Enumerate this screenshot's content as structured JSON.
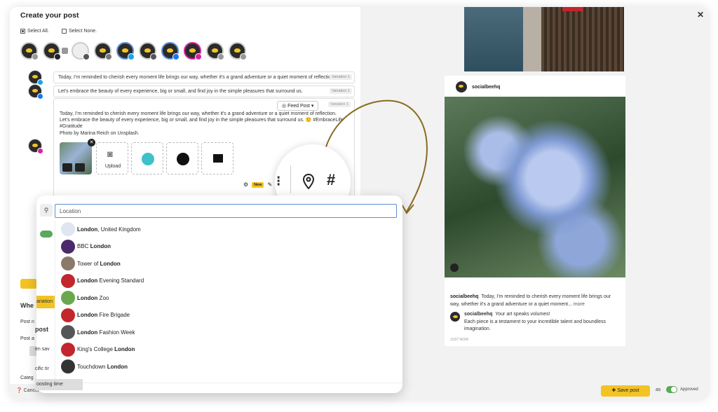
{
  "composer": {
    "title": "Create your post",
    "select_all": "Select All.",
    "select_none": "Select None.",
    "variations": [
      {
        "text": "Today, I'm reminded to cherish every moment life brings our way, whether it's a grand adventure or a quiet moment of reflection",
        "tag": "Variation 1"
      },
      {
        "text": "Let's embrace the beauty of every experience, big or small, and find joy in the simple pleasures that surround us.",
        "tag": "Variation 1"
      }
    ],
    "editor": {
      "post_type": "Feed Post",
      "tag": "Variation 1",
      "line1": "Today, I'm reminded to cherish every moment life brings our way, whether it's a grand adventure or a quiet moment of reflection.",
      "line2": "Let's embrace the beauty of every experience, big or small, and find joy in the simple pleasures that surround us. 🙂 #EmbraceLife",
      "line3": "#Gratitude",
      "line4": "Photo by Marina Reich on Unsplash.",
      "upload_label": "Upload",
      "new_badge": "New"
    },
    "partial_labels": {
      "when": "Whe",
      "post": "post",
      "variation": "ariation",
      "post_n": "Post n",
      "post_a": "Post a",
      "then_save": "en sav",
      "specific": "cific tir",
      "boosting": "oosting time",
      "category": "Categ"
    }
  },
  "location_dropdown": {
    "placeholder": "Location",
    "results": [
      {
        "bold": "London",
        "rest": ", United Kingdom",
        "prefix": "",
        "logo_color": "#dfe6f0"
      },
      {
        "bold": "London",
        "rest": "",
        "prefix": "BBC ",
        "logo_color": "#4a2a6a"
      },
      {
        "bold": "London",
        "rest": "",
        "prefix": "Tower of ",
        "logo_color": "#8a7a6a"
      },
      {
        "bold": "London",
        "rest": " Evening Standard",
        "prefix": "",
        "logo_color": "#c1272d"
      },
      {
        "bold": "London",
        "rest": " Zoo",
        "prefix": "",
        "logo_color": "#6aa84f"
      },
      {
        "bold": "London",
        "rest": " Fire Brigade",
        "prefix": "",
        "logo_color": "#c1272d"
      },
      {
        "bold": "London",
        "rest": " Fashion Week",
        "prefix": "",
        "logo_color": "#555555"
      },
      {
        "bold": "London",
        "rest": "",
        "prefix": "King's College ",
        "logo_color": "#c1272d"
      },
      {
        "bold": "London",
        "rest": "",
        "prefix": "Touchdown ",
        "logo_color": "#333333"
      }
    ]
  },
  "preview": {
    "account": "socialbeehq",
    "caption_user": "socialbeehq",
    "caption_text": "Today, I'm reminded to cherish every moment life brings our way, whether it's a grand adventure or a quiet moment...",
    "more": "more",
    "comment_user": "socialbeehq",
    "comment_text1": "Your art speaks volumes!",
    "comment_text2": "Each piece is a testament to your incredible talent and boundless imagination.",
    "time": "JUST NOW"
  },
  "footer": {
    "cancel": "Cancel",
    "save": "Save post",
    "as": "as",
    "approved": "Approved"
  },
  "colors": {
    "brand_yellow": "#f3c324",
    "arrow_brown": "#8a6a1f",
    "focus_blue": "#5b8fd6"
  }
}
